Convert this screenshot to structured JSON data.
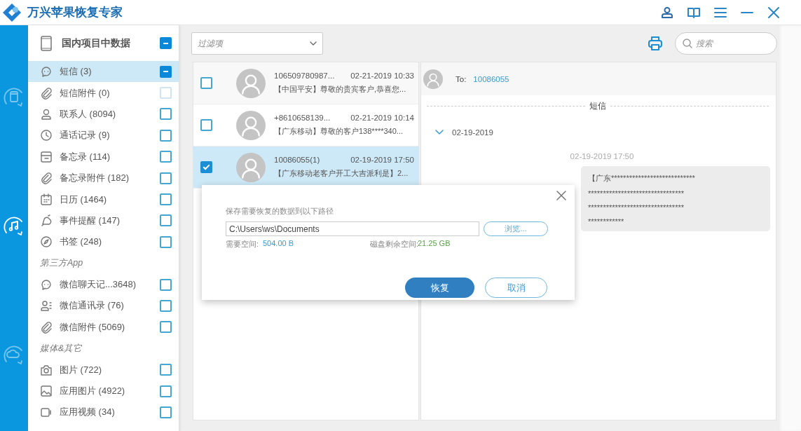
{
  "app": {
    "title": "万兴苹果恢复专家"
  },
  "rail": [
    {
      "kind": "device",
      "selected": false
    },
    {
      "kind": "music",
      "selected": true
    },
    {
      "kind": "cloud",
      "selected": false
    }
  ],
  "sidebar": {
    "header": {
      "label": "国内项目中数据",
      "partial": true
    },
    "items": [
      {
        "kind": "item",
        "label": "短信 (3)",
        "selected": true,
        "partial": true,
        "disabled": false
      },
      {
        "kind": "item",
        "label": "短信附件 (0)",
        "selected": false,
        "partial": false,
        "disabled": true
      },
      {
        "kind": "item",
        "label": "联系人 (8094)",
        "selected": false,
        "partial": false,
        "disabled": false
      },
      {
        "kind": "item",
        "label": "通话记录 (9)",
        "selected": false,
        "partial": false,
        "disabled": false
      },
      {
        "kind": "item",
        "label": "备忘录 (114)",
        "selected": false,
        "partial": false,
        "disabled": false
      },
      {
        "kind": "item",
        "label": "备忘录附件 (182)",
        "selected": false,
        "partial": false,
        "disabled": false
      },
      {
        "kind": "item",
        "label": "日历 (1464)",
        "selected": false,
        "partial": false,
        "disabled": false
      },
      {
        "kind": "item",
        "label": "事件提醒 (147)",
        "selected": false,
        "partial": false,
        "disabled": false
      },
      {
        "kind": "item",
        "label": "书签 (248)",
        "selected": false,
        "partial": false,
        "disabled": false
      },
      {
        "kind": "section",
        "label": "第三方App"
      },
      {
        "kind": "item",
        "label": "微信聊天记...3648)",
        "selected": false,
        "partial": false,
        "disabled": false
      },
      {
        "kind": "item",
        "label": "微信通讯录 (76)",
        "selected": false,
        "partial": false,
        "disabled": false
      },
      {
        "kind": "item",
        "label": "微信附件 (5069)",
        "selected": false,
        "partial": false,
        "disabled": false
      },
      {
        "kind": "section",
        "label": "媒体&其它"
      },
      {
        "kind": "item",
        "label": "图片 (722)",
        "selected": false,
        "partial": false,
        "disabled": false
      },
      {
        "kind": "item",
        "label": "应用图片 (4922)",
        "selected": false,
        "partial": false,
        "disabled": false
      },
      {
        "kind": "item",
        "label": "应用视频 (34)",
        "selected": false,
        "partial": false,
        "disabled": false
      }
    ]
  },
  "toolbar": {
    "filter": {
      "placeholder": "过滤项"
    },
    "search": {
      "placeholder": "搜索"
    }
  },
  "messages": [
    {
      "sender": "106509780987...",
      "time": "02-21-2019 10:33",
      "preview": "【中国平安】尊敬的贵宾客户,恭喜您...",
      "checked": false,
      "selected": false
    },
    {
      "sender": "+8610658139...",
      "time": "02-21-2019 10:14",
      "preview": "【广东移动】尊敬的客户138****340...",
      "checked": false,
      "selected": false
    },
    {
      "sender": "10086055(1)",
      "time": "02-19-2019 17:50",
      "preview": "【广东移动老客户开工大吉派利是】2...",
      "checked": true,
      "selected": true
    }
  ],
  "detail": {
    "to_label": "To:",
    "to": "10086055",
    "divider": "短信",
    "date_group": {
      "label": "02-19-2019",
      "expanded": true
    },
    "message_time": "02-19-2019 17:50",
    "bubble_lines": [
      "【广东****************************",
      "********************************",
      "********************************",
      "************"
    ]
  },
  "dialog": {
    "label": "保存需要恢复的数据到以下路径",
    "path": "C:\\Users\\ws\\Documents",
    "browse": "浏览...",
    "need_label": "需要空间:",
    "need_value": "504.00 B",
    "free_label": "磁盘剩余空间:",
    "free_value": "21.25 GB",
    "buttons": [
      {
        "label": "恢复",
        "kind": "primary"
      },
      {
        "label": "取消",
        "kind": "secondary"
      }
    ]
  }
}
